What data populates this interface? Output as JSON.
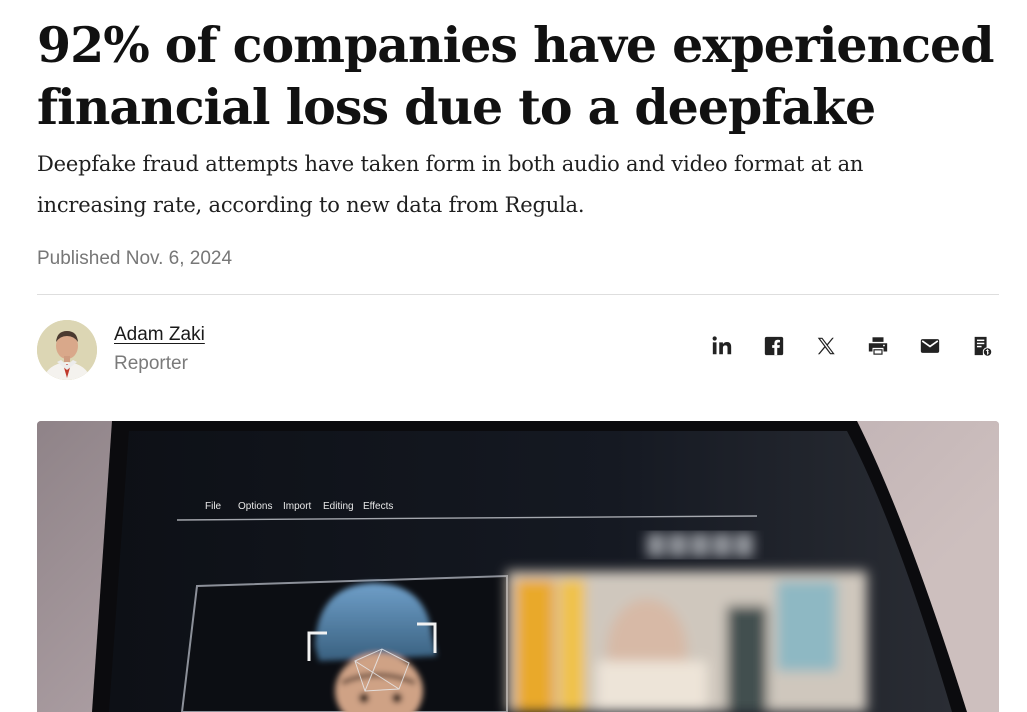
{
  "article": {
    "headline": "92% of companies have experienced financial loss due to a deepfake",
    "dek": "Deepfake fraud attempts have taken form in both audio and video format at an increasing rate, according to new data from Regula.",
    "published": "Published Nov. 6, 2024"
  },
  "author": {
    "name": "Adam Zaki",
    "role": "Reporter"
  },
  "share": [
    {
      "name": "linkedin-icon"
    },
    {
      "name": "facebook-icon"
    },
    {
      "name": "x-icon"
    },
    {
      "name": "print-icon"
    },
    {
      "name": "email-icon"
    },
    {
      "name": "license-icon"
    }
  ],
  "hero": {
    "menu": [
      "File",
      "Options",
      "Import",
      "Editing",
      "Effects"
    ]
  },
  "colors": {
    "text": "#111111",
    "muted": "#777777",
    "divider": "#dedede"
  }
}
